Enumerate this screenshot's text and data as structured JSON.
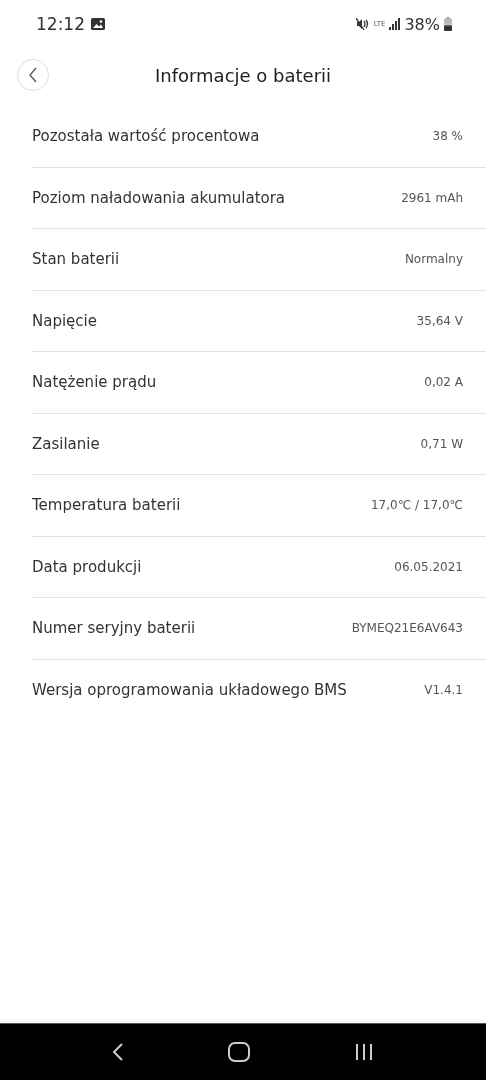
{
  "status_bar": {
    "time": "12:12",
    "network": "LTE",
    "battery": "38%"
  },
  "header": {
    "title": "Informacje o baterii"
  },
  "rows": [
    {
      "label": "Pozostała wartość procentowa",
      "value": "38 %"
    },
    {
      "label": "Poziom naładowania akumulatora",
      "value": "2961 mAh"
    },
    {
      "label": "Stan baterii",
      "value": "Normalny"
    },
    {
      "label": "Napięcie",
      "value": "35,64 V"
    },
    {
      "label": "Natężenie prądu",
      "value": "0,02 A"
    },
    {
      "label": "Zasilanie",
      "value": "0,71 W"
    },
    {
      "label": "Temperatura baterii",
      "value": "17,0℃ / 17,0℃"
    },
    {
      "label": "Data produkcji",
      "value": "06.05.2021"
    },
    {
      "label": "Numer seryjny baterii",
      "value": "BYMEQ21E6AV643"
    },
    {
      "label": "Wersja oprogramowania układowego BMS",
      "value": "V1.4.1"
    }
  ]
}
